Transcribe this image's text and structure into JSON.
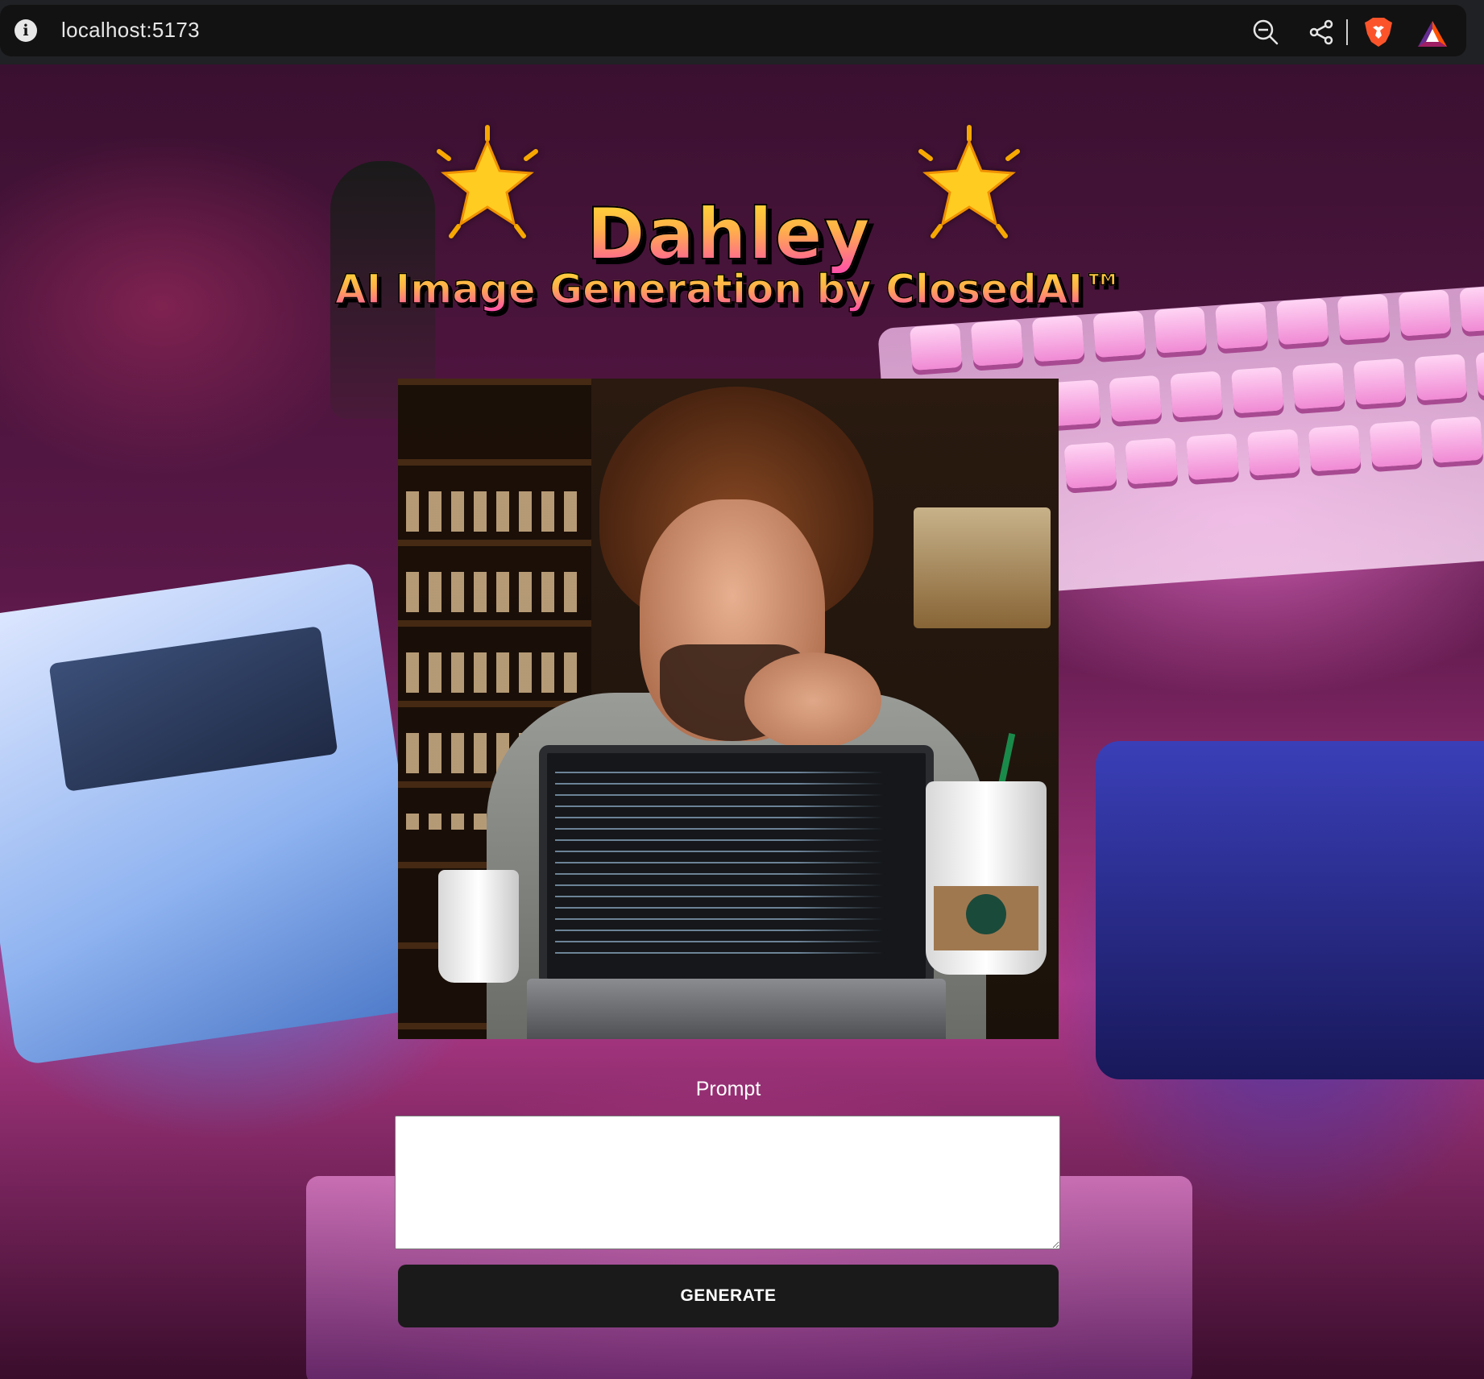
{
  "browser": {
    "url": "localhost:5173",
    "icons": [
      "info-icon",
      "zoom-out-icon",
      "share-icon",
      "brave-lion-icon",
      "bat-rewards-icon"
    ]
  },
  "header": {
    "title": "Dahley",
    "subtitle": "AI Image Generation by ClosedAI™",
    "decoration_icon": "star-emoji-icon"
  },
  "main": {
    "generated_image_icon": "generated-image",
    "prompt_label": "Prompt",
    "prompt_value": "",
    "prompt_placeholder": "",
    "generate_label": "GENERATE"
  },
  "colors": {
    "title_gradient_top": "#ffe030",
    "title_gradient_bottom": "#ff4ab0",
    "button_bg": "#1a1a1a",
    "button_text": "#ffffff"
  }
}
